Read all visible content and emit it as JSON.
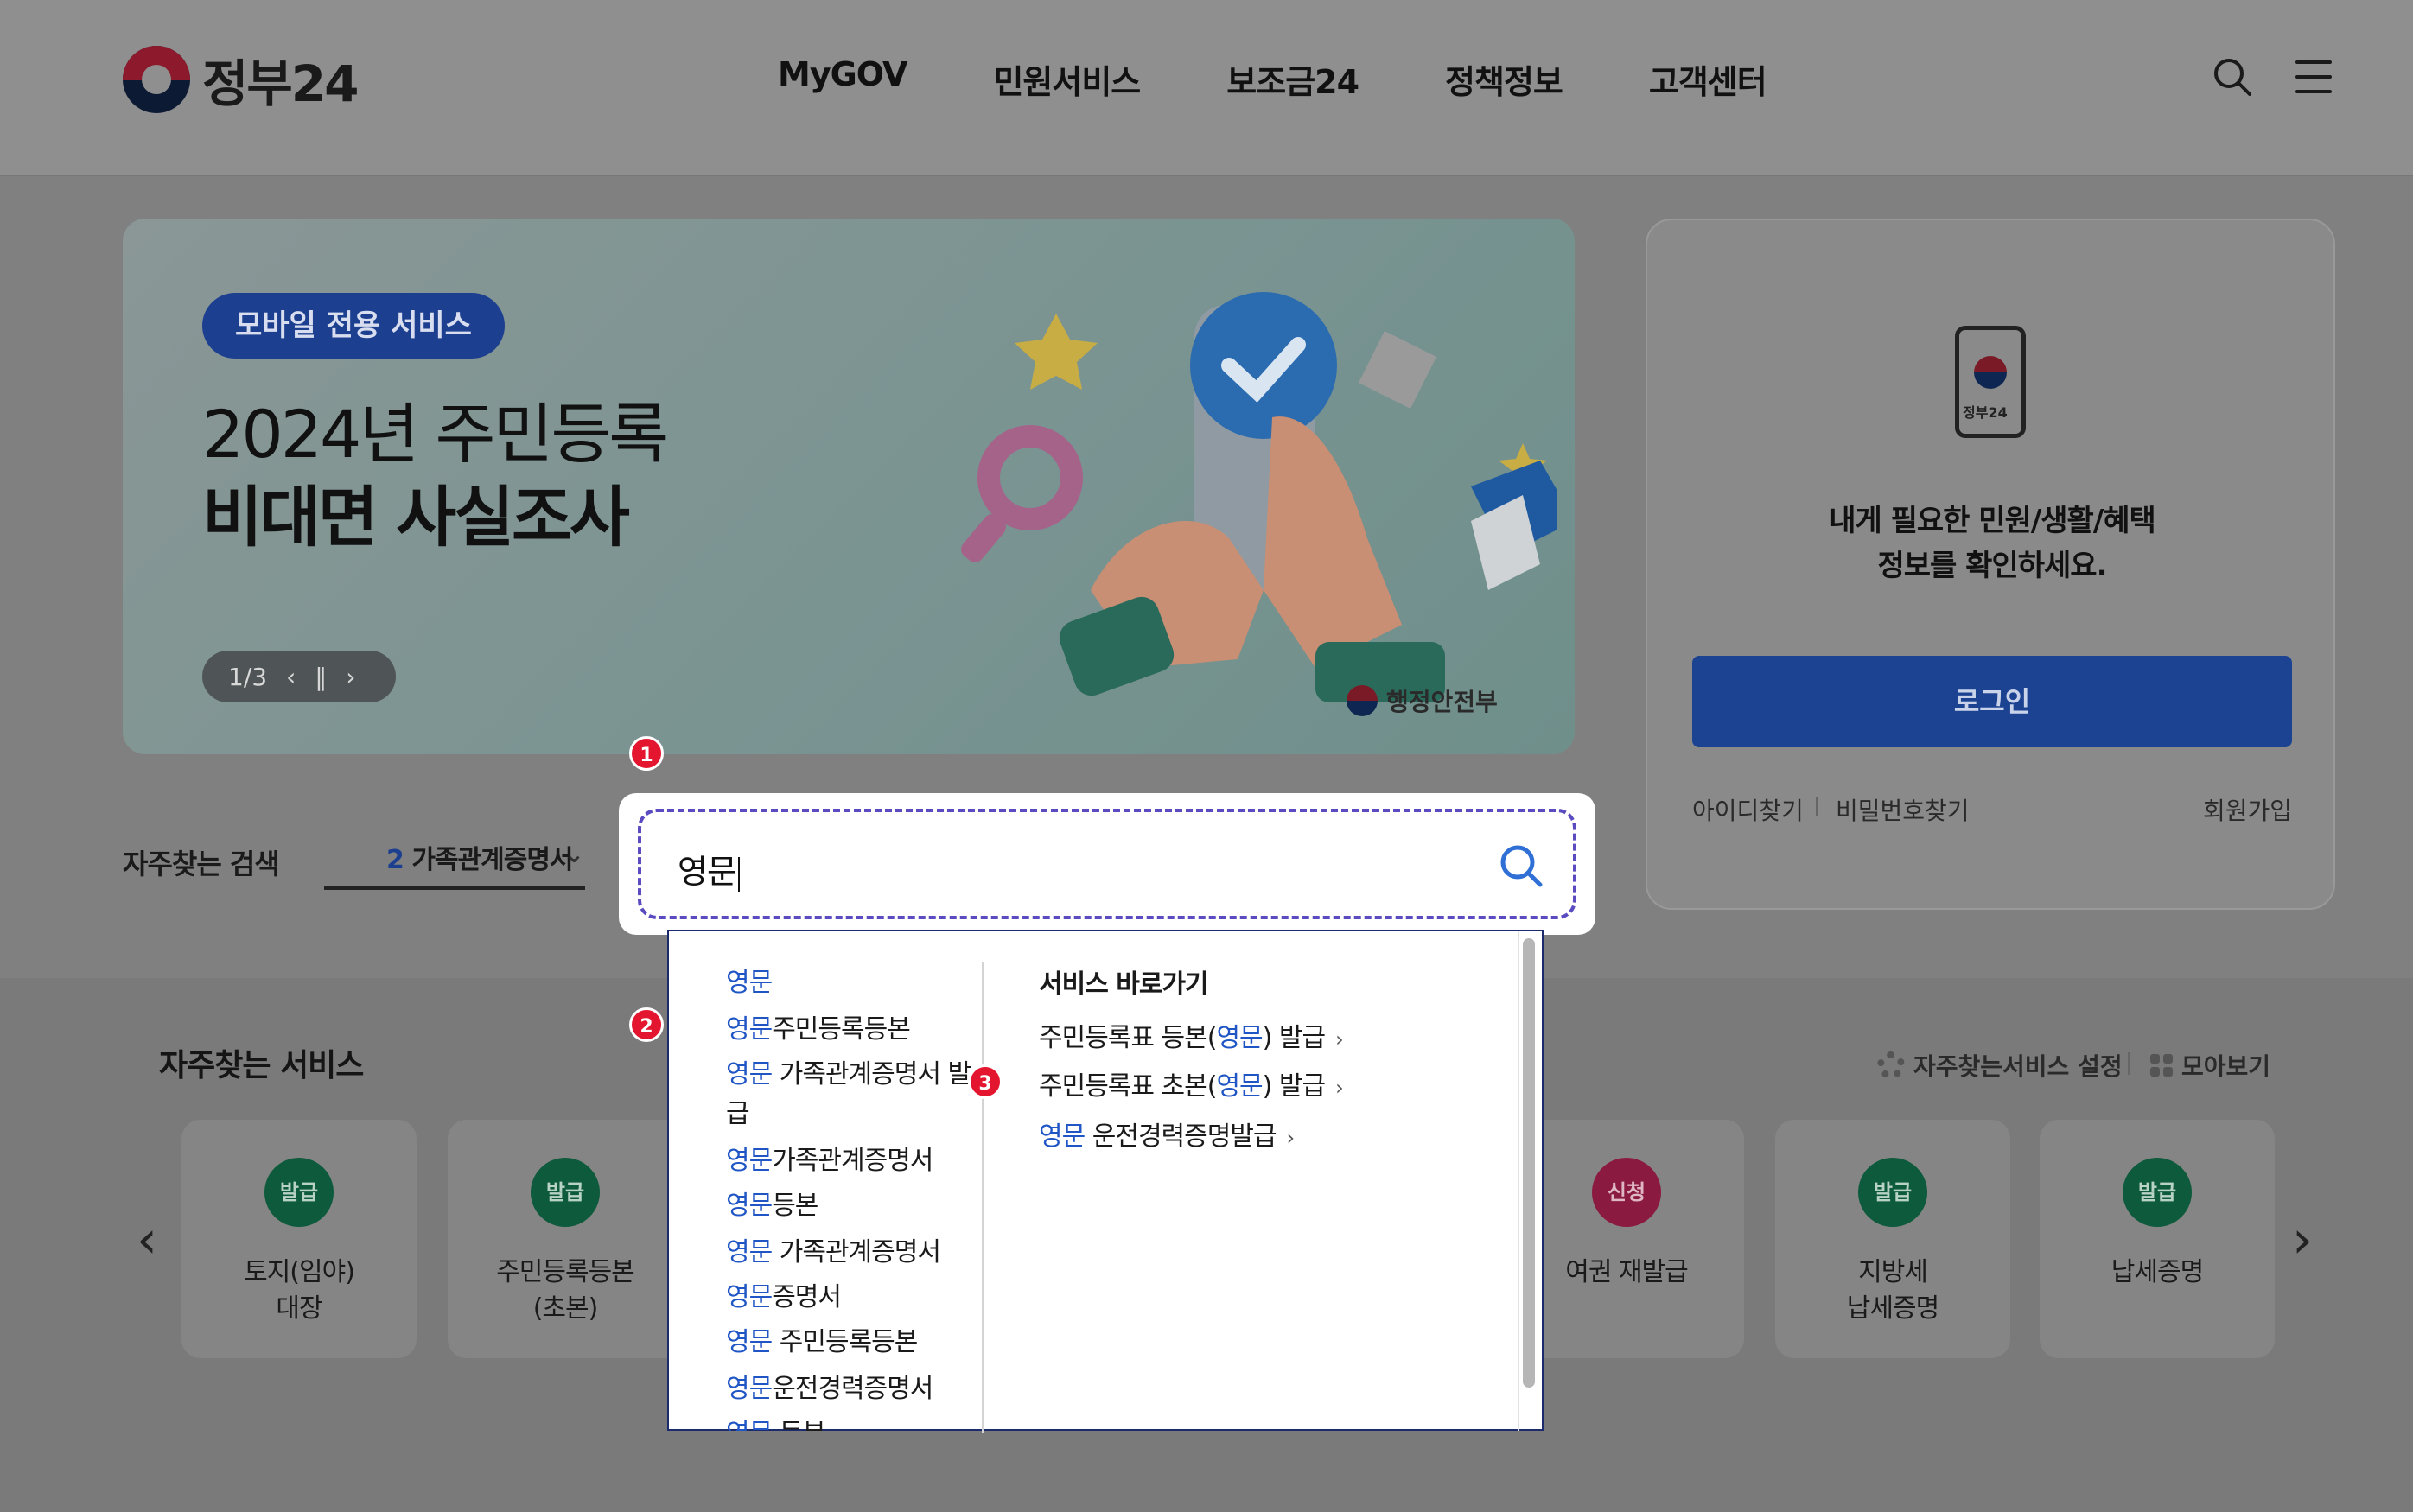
{
  "header": {
    "logo_text": "정부24",
    "nav": [
      "MyGOV",
      "민원서비스",
      "보조금24",
      "정책정보",
      "고객센터"
    ],
    "icons": [
      "search-icon",
      "menu-icon"
    ]
  },
  "banner": {
    "badge": "모바일 전용 서비스",
    "title_line1": "2024년 주민등록",
    "title_line2": "비대면 사실조사",
    "pager_text": "1/3",
    "ministry": "행정안전부"
  },
  "login": {
    "phone_label": "정부24",
    "message_line1": "내게 필요한 민원/생활/혜택",
    "message_line2": "정보를 확인하세요.",
    "button": "로그인",
    "find_id": "아이디찾기",
    "find_pw": "비밀번호찾기",
    "signup": "회원가입"
  },
  "frequent_search": {
    "label": "자주찾는 검색",
    "rank": "2",
    "value": "가족관계증명서"
  },
  "search": {
    "value": "영문",
    "icon": "search-icon"
  },
  "suggestions": [
    {
      "hl": "영문",
      "rest": ""
    },
    {
      "hl": "영문",
      "rest": "주민등록등본"
    },
    {
      "hl": "영문",
      "rest": " 가족관계증명서 발"
    },
    {
      "hl": "",
      "rest": "급"
    },
    {
      "hl": "영문",
      "rest": "가족관계증명서"
    },
    {
      "hl": "영문",
      "rest": "등본"
    },
    {
      "hl": "영문",
      "rest": " 가족관계증명서"
    },
    {
      "hl": "영문",
      "rest": "증명서"
    },
    {
      "hl": "영문",
      "rest": " 주민등록등본"
    },
    {
      "hl": "영문",
      "rest": "운전경력증명서"
    },
    {
      "hl": "영문",
      "rest": " 등본"
    }
  ],
  "quick": {
    "title": "서비스 바로가기",
    "items": [
      {
        "pre": "주민등록표 등본(",
        "hl": "영문",
        "post": ") 발급"
      },
      {
        "pre": "주민등록표 초본(",
        "hl": "영문",
        "post": ") 발급"
      },
      {
        "pre": "",
        "hl": "영문",
        "post": " 운전경력증명발급"
      }
    ]
  },
  "markers": [
    "1",
    "2",
    "3"
  ],
  "services": {
    "title": "자주찾는 서비스",
    "settings": "자주찾는서비스 설정",
    "view_all": "모아보기",
    "cards": [
      {
        "tag": "발급",
        "label": "토지(임야)\n대장",
        "color": "green"
      },
      {
        "tag": "발급",
        "label": "주민등록등본\n(초본)",
        "color": "green"
      },
      {
        "tag": "신청",
        "label": "여권 재발급",
        "color": "red"
      },
      {
        "tag": "발급",
        "label": "지방세\n납세증명",
        "color": "green"
      },
      {
        "tag": "발급",
        "label": "납세증명",
        "color": "green"
      }
    ]
  },
  "colors": {
    "brand_blue": "#1c4391",
    "highlight_blue": "#1f55c4",
    "marker_red": "#e4152f",
    "issue_green": "#0d5a3c",
    "apply_red": "#8a1a40"
  }
}
